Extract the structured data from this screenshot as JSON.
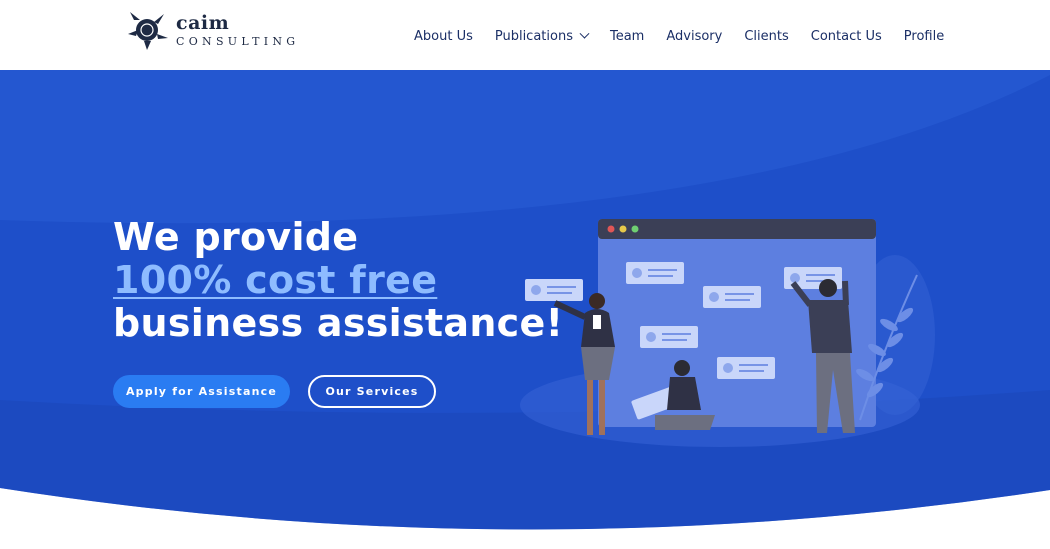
{
  "header": {
    "logo": {
      "name": "caim",
      "tagline": "CONSULTING"
    },
    "nav": [
      {
        "label": "About Us"
      },
      {
        "label": "Publications",
        "has_dropdown": true
      },
      {
        "label": "Team"
      },
      {
        "label": "Advisory"
      },
      {
        "label": "Clients"
      },
      {
        "label": "Contact Us"
      },
      {
        "label": "Profile"
      }
    ]
  },
  "hero": {
    "headline_line1": "We provide",
    "headline_line2": "100% cost free",
    "headline_line3": "business assistance!",
    "primary_button": "Apply for Assistance",
    "secondary_button": "Our Services"
  },
  "colors": {
    "brand_navy": "#1b2f66",
    "hero_blue": "#1e4fc9",
    "accent_light_blue": "#8ebcff",
    "button_blue": "#2a7cf2"
  }
}
